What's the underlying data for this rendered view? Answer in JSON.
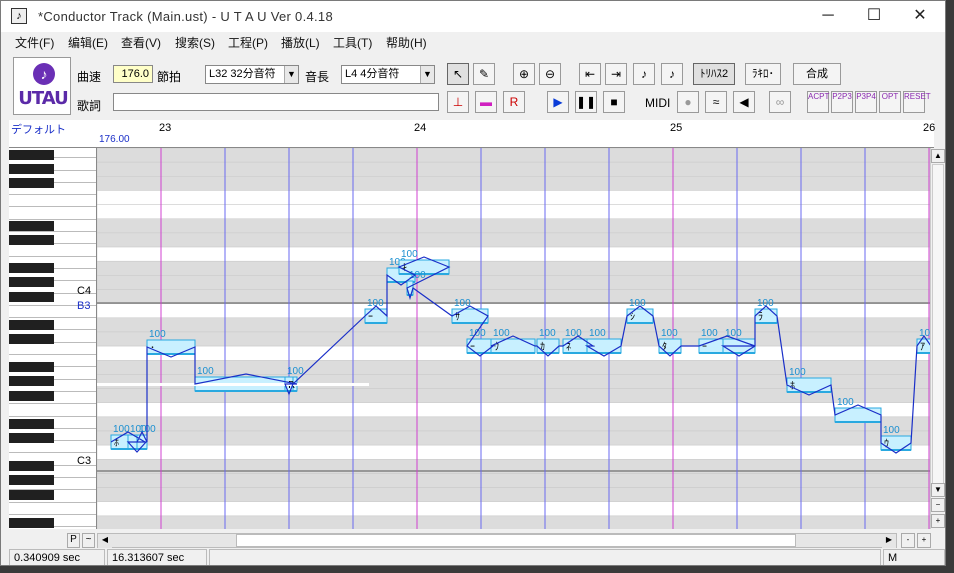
{
  "window": {
    "icon": "music-note-icon",
    "title": "*Conductor Track (Main.ust) - U T A U  Ver 0.4.18",
    "controls": [
      "─",
      "☐",
      "✕"
    ]
  },
  "menu": [
    "文件(F)",
    "编辑(E)",
    "查看(V)",
    "搜索(S)",
    "工程(P)",
    "播放(L)",
    "工具(T)",
    "帮助(H)"
  ],
  "logo": {
    "text": "UTAU",
    "icon": "music-note-icon"
  },
  "toolbar": {
    "tempo_label": "曲速",
    "tempo_value": "176.0",
    "beat_label": "節拍",
    "quantize_value": "L32 32分音符",
    "length_label": "音長",
    "length_value": "L4  4分音符",
    "lyric_label": "歌詞",
    "lyric_value": "",
    "preset_btn": "ﾄﾘﾊｽ2",
    "record_btn": "ﾗｷﾛ･",
    "render_btn": "合成",
    "midi_label": "MIDI",
    "plugin_labels": [
      "ACPT",
      "P2P3",
      "P3P4",
      "OPT",
      "RESET"
    ]
  },
  "editor": {
    "track_name": "デフォルト",
    "tempo_marker": "176.00",
    "measures": [
      "23",
      "24",
      "25",
      "26"
    ],
    "key_labels": [
      "C4",
      "B3",
      "C3"
    ],
    "notes": [
      {
        "lyric": "ﾎ",
        "velocity": "100"
      },
      {
        "lyric": "",
        "velocity": "100"
      },
      {
        "lyric": "",
        "velocity": "100"
      },
      {
        "lyric": "･",
        "velocity": "100"
      },
      {
        "lyric": "･",
        "velocity": "100"
      },
      {
        "lyric": "R",
        "velocity": "100"
      },
      {
        "lyric": "ｰ",
        "velocity": "100"
      },
      {
        "lyric": "",
        "velocity": "100"
      },
      {
        "lyric": "ｷ",
        "velocity": "100"
      },
      {
        "lyric": "",
        "velocity": "100"
      },
      {
        "lyric": "ｻ",
        "velocity": "100"
      },
      {
        "lyric": "ｰ",
        "velocity": "100"
      },
      {
        "lyric": "ｳ",
        "velocity": "100"
      },
      {
        "lyric": "ｶ",
        "velocity": "100"
      },
      {
        "lyric": "ﾈ",
        "velocity": "100"
      },
      {
        "lyric": "ｰ",
        "velocity": "100"
      },
      {
        "lyric": "ｼ",
        "velocity": "100"
      },
      {
        "lyric": "ﾀ",
        "velocity": "100"
      },
      {
        "lyric": "ｰ",
        "velocity": "100"
      },
      {
        "lyric": "ｰ",
        "velocity": "100"
      },
      {
        "lyric": "ﾗ",
        "velocity": "100"
      },
      {
        "lyric": "ﾎ",
        "velocity": "100"
      },
      {
        "lyric": "",
        "velocity": "100"
      },
      {
        "lyric": "ｳ",
        "velocity": "100"
      },
      {
        "lyric": "ｱ",
        "velocity": "10"
      }
    ]
  },
  "status": {
    "p_btn": "P",
    "tilde_btn": "~",
    "time1": "0.340909 sec",
    "time2": "16.313607 sec",
    "mode": "M",
    "zoom_minus": "-",
    "zoom_plus": "+"
  }
}
